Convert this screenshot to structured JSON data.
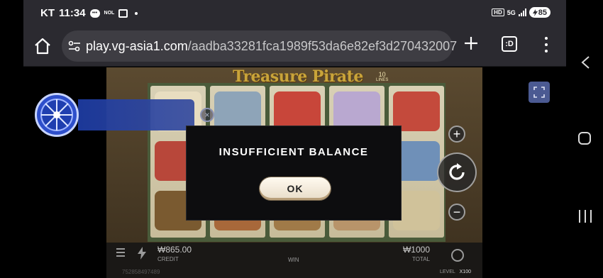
{
  "status_bar": {
    "carrier": "KT",
    "time": "11:34",
    "nol_label": "NOL",
    "hd_label": "HD",
    "network_label": "5G",
    "battery": "85"
  },
  "browser": {
    "url_host": "play.vg-asia1.com",
    "url_path": "/aadba33281fca1989f53da6e82ef3d270432007",
    "tab_label": ":D"
  },
  "game": {
    "title": "Treasure Pirate",
    "lines_count": "10",
    "lines_label": "LINES",
    "credit_value": "₩865.00",
    "credit_label": "CREDIT",
    "win_label": "WIN",
    "total_value": "₩1000",
    "total_label": "TOTAL",
    "account_id": "752858497489",
    "level_label": "LEVEL",
    "level_value": "X100"
  },
  "overlay": {
    "close_glyph": "×"
  },
  "modal": {
    "message": "INSUFFICIENT BALANCE",
    "ok_label": "OK"
  },
  "colors": {
    "chrome_bg": "#2b2a30",
    "url_field_bg": "#3e3d43",
    "modal_bg": "#0d0d0f",
    "wheel_blue": "#2e4fcb",
    "logo_gold": "#c9a43a"
  }
}
